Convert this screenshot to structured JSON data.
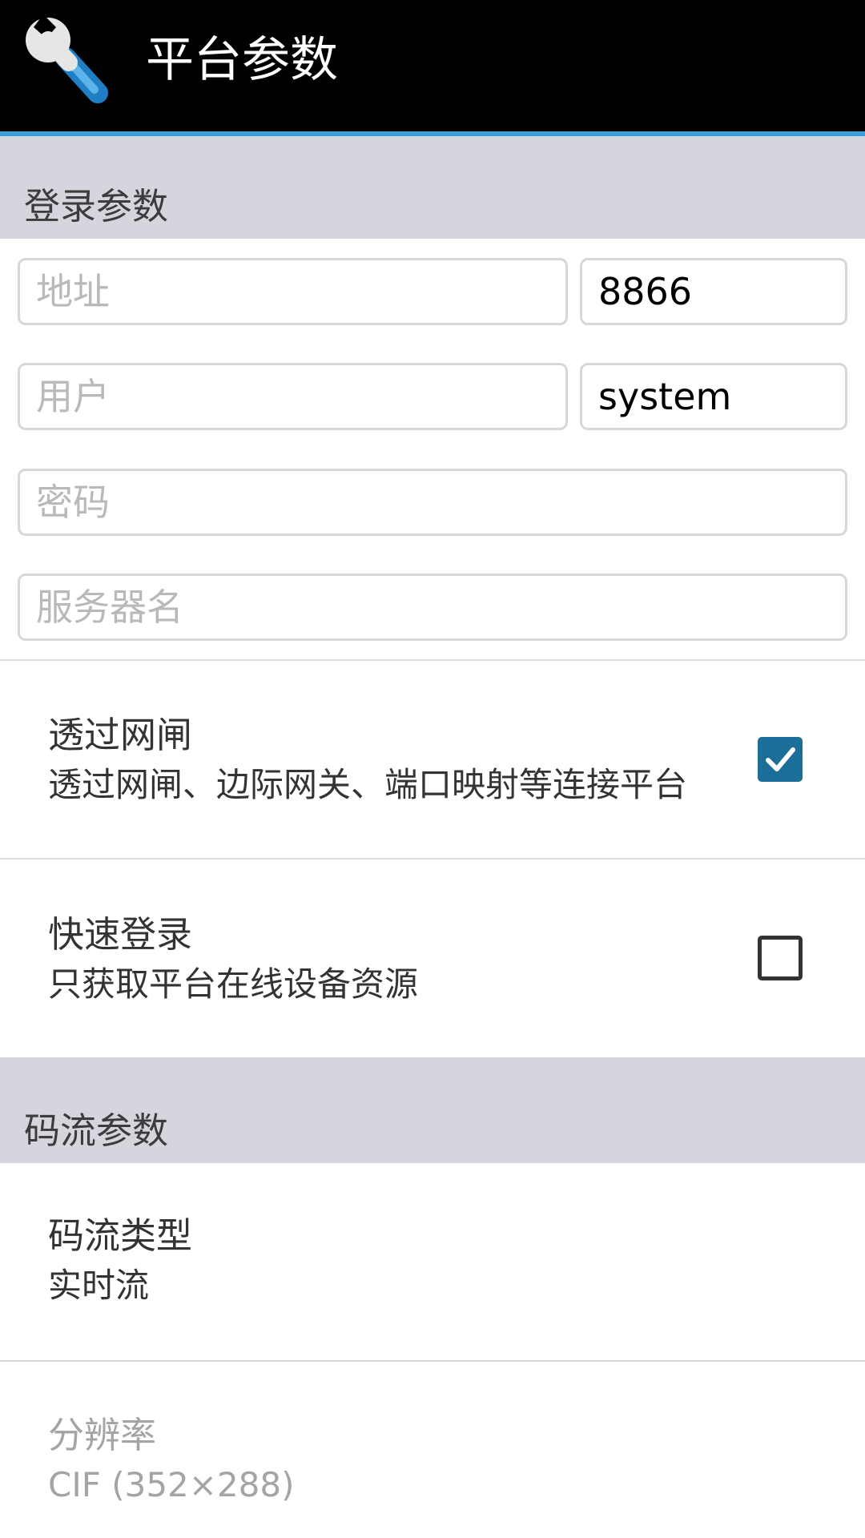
{
  "app_bar": {
    "title": "平台参数",
    "icon": "wrench-icon"
  },
  "login_section": {
    "header": "登录参数",
    "address": {
      "placeholder": "地址",
      "value": ""
    },
    "port": {
      "value": "8866"
    },
    "user": {
      "placeholder": "用户",
      "value": ""
    },
    "user_type": {
      "value": "system"
    },
    "password": {
      "placeholder": "密码",
      "value": ""
    },
    "server_name": {
      "placeholder": "服务器名",
      "value": ""
    }
  },
  "gateway": {
    "title": "透过网闸",
    "summary": "透过网闸、边际网关、端口映射等连接平台",
    "checked": true
  },
  "quick_login": {
    "title": "快速登录",
    "summary": "只获取平台在线设备资源",
    "checked": false
  },
  "stream_section": {
    "header": "码流参数",
    "stream_type": {
      "title": "码流类型",
      "summary": "实时流"
    },
    "resolution": {
      "title": "分辨率",
      "summary": "CIF (352×288)",
      "enabled": false
    }
  },
  "colors": {
    "app_bar": "#000000",
    "accent_line": "#3aa0dc",
    "section_bg": "#d5d5dd",
    "checkbox_checked": "#1a6e97"
  }
}
